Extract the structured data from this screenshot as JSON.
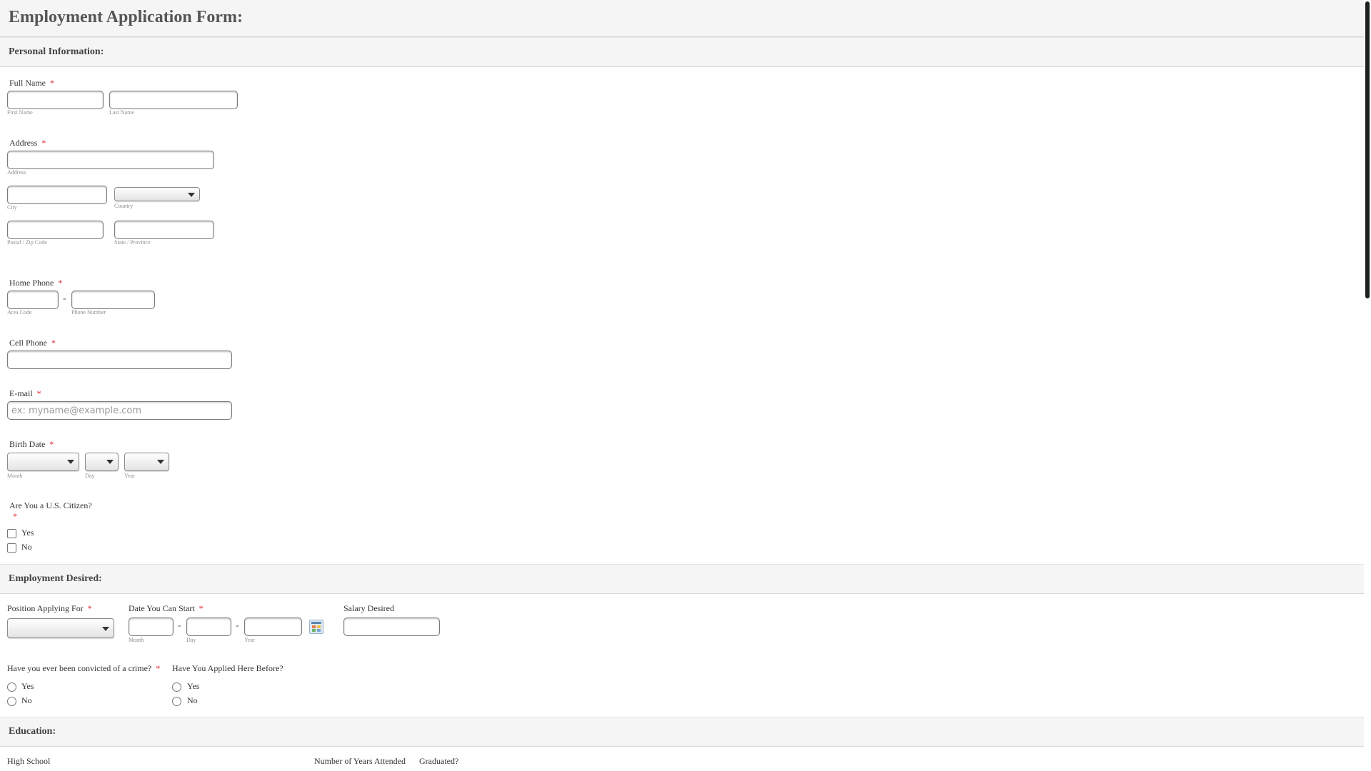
{
  "form": {
    "title": "Employment Application Form:"
  },
  "sections": {
    "personal": "Personal Information:",
    "employment": "Employment Desired:",
    "education": "Education:"
  },
  "required_mark": "*",
  "full_name": {
    "label": "Full Name",
    "first_sub": "First Name",
    "last_sub": "Last Name",
    "first_value": "",
    "last_value": ""
  },
  "address": {
    "label": "Address",
    "address_sub": "Address",
    "city_sub": "City",
    "country_sub": "Country",
    "country_value": "",
    "postal_sub": "Postal / Zip Code",
    "state_sub": "State / Province"
  },
  "home_phone": {
    "label": "Home Phone",
    "area_sub": "Area Code",
    "number_sub": "Phone Number",
    "separator": "-"
  },
  "cell_phone": {
    "label": "Cell Phone",
    "value": ""
  },
  "email": {
    "label": "E-mail",
    "placeholder": "ex: myname@example.com"
  },
  "birth_date": {
    "label": "Birth Date",
    "month_sub": "Month",
    "day_sub": "Day",
    "year_sub": "Year",
    "month_value": "",
    "day_value": "",
    "year_value": ""
  },
  "citizen": {
    "label": "Are You a U.S. Citizen?",
    "options": [
      "Yes",
      "No"
    ]
  },
  "position": {
    "label": "Position Applying For",
    "value": ""
  },
  "start_date": {
    "label": "Date You Can Start",
    "month_sub": "Month",
    "day_sub": "Day",
    "year_sub": "Year",
    "separator": "-",
    "calendar_icon": "calendar-icon"
  },
  "salary": {
    "label": "Salary Desired",
    "value": ""
  },
  "crime": {
    "label": "Have you ever been convicted of a crime?",
    "options": [
      "Yes",
      "No"
    ]
  },
  "applied_before": {
    "label": "Have You Applied Here Before?",
    "options": [
      "Yes",
      "No"
    ]
  },
  "education": {
    "high_school": "High School",
    "years_attended": "Number of Years Attended",
    "graduated": "Graduated?"
  }
}
